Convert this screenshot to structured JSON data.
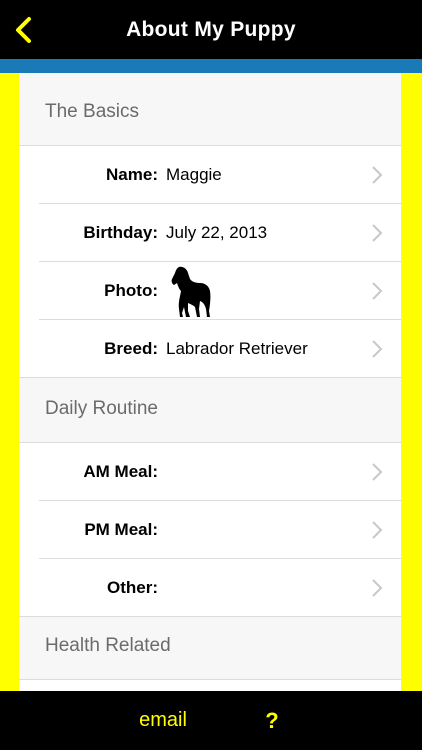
{
  "header": {
    "title": "About My Puppy",
    "back_icon": "chevron-left-icon"
  },
  "colors": {
    "brand_yellow": "#ffff00",
    "header_bg": "#000000",
    "accent_bar": "#1a7ab8",
    "section_bg": "#f7f7f7"
  },
  "sections": {
    "basics": {
      "title": "The Basics",
      "rows": {
        "name": {
          "label": "Name:",
          "value": "Maggie"
        },
        "birthday": {
          "label": "Birthday:",
          "value": "July 22, 2013"
        },
        "photo": {
          "label": "Photo:",
          "icon": "dog-silhouette-icon"
        },
        "breed": {
          "label": "Breed:",
          "value": "Labrador Retriever"
        }
      }
    },
    "routine": {
      "title": "Daily Routine",
      "rows": {
        "am_meal": {
          "label": "AM Meal:",
          "value": ""
        },
        "pm_meal": {
          "label": "PM Meal:",
          "value": ""
        },
        "other": {
          "label": "Other:",
          "value": ""
        }
      }
    },
    "health": {
      "title": "Health Related"
    }
  },
  "footer": {
    "email_label": "email",
    "help_label": "?"
  }
}
